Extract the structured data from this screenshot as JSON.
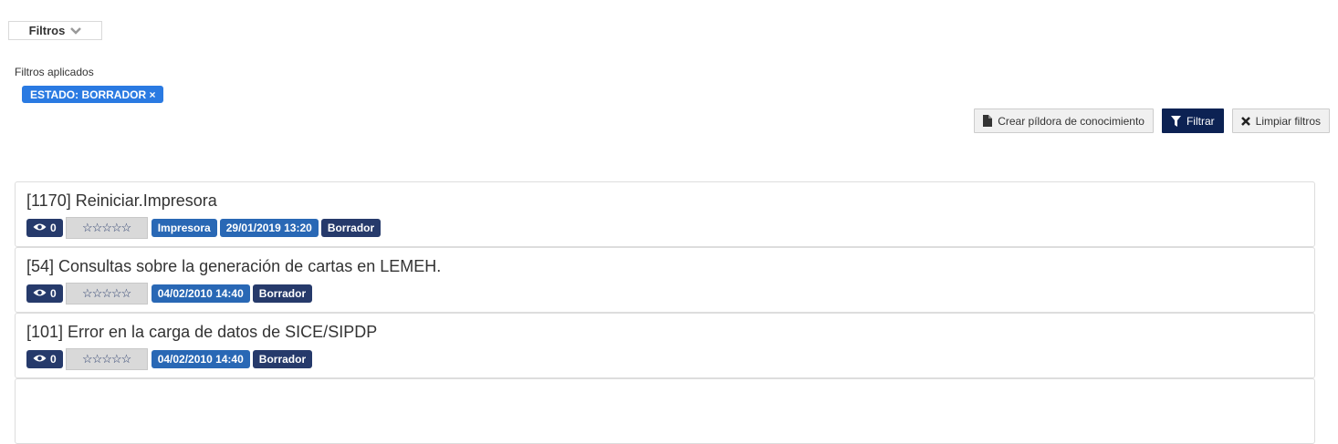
{
  "filters": {
    "toggle_label": "Filtros",
    "applied_label": "Filtros aplicados"
  },
  "applied_filters": [
    {
      "label": "ESTADO: BORRADOR ×"
    }
  ],
  "actions": {
    "create_label": "Crear píldora de conocimiento",
    "filter_label": "Filtrar",
    "clear_label": "Limpiar filtros"
  },
  "results": [
    {
      "title": "[1170] Reiniciar.Impresora",
      "views": "0",
      "rating": "☆☆☆☆☆",
      "category": "Impresora",
      "date": "29/01/2019 13:20",
      "status": "Borrador"
    },
    {
      "title": "[54] Consultas sobre la generación de cartas en LEMEH.",
      "views": "0",
      "rating": "☆☆☆☆☆",
      "category": "",
      "date": "04/02/2010 14:40",
      "status": "Borrador"
    },
    {
      "title": "[101] Error en la carga de datos de SICE/SIPDP",
      "views": "0",
      "rating": "☆☆☆☆☆",
      "category": "",
      "date": "04/02/2010 14:40",
      "status": "Borrador"
    }
  ],
  "colors": {
    "primary": "#0c2253",
    "chip": "#2a7ae2",
    "badge_dark": "#263a6b",
    "badge_blue": "#2968b5"
  },
  "icons": {
    "toggle": "chevron-down-icon",
    "create": "file-icon",
    "filter": "funnel-icon",
    "clear": "times-icon",
    "views": "eye-icon"
  }
}
